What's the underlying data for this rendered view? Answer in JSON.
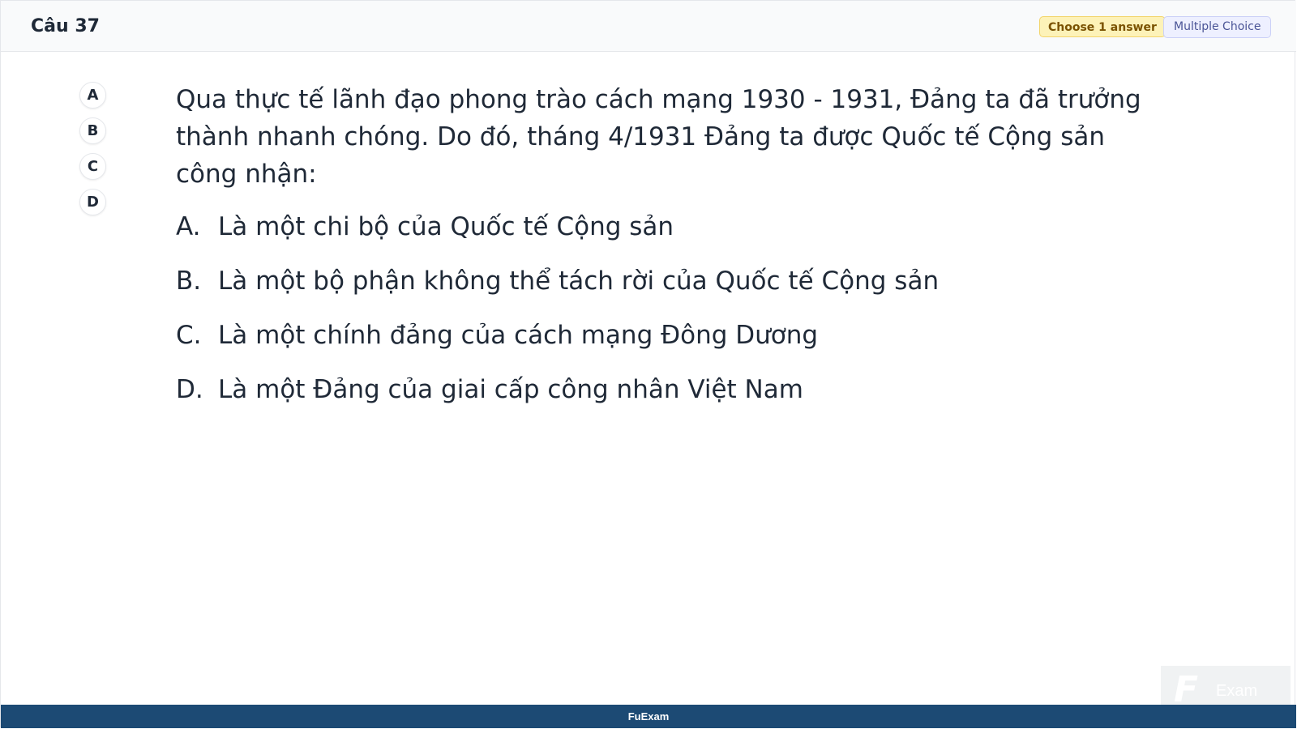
{
  "header": {
    "title": "Câu 37",
    "badge_choose": "Choose 1 answer",
    "badge_type": "Multiple Choice"
  },
  "option_buttons": [
    "A",
    "B",
    "C",
    "D"
  ],
  "question": {
    "text": "Qua thực tế lãnh đạo phong trào cách mạng 1930 - 1931, Đảng ta đã trưởng thành nhanh chóng. Do đó, tháng 4/1931 Đảng ta được Quốc tế Cộng sản công nhận:"
  },
  "answers": [
    {
      "letter": "A.",
      "text": "Là một chi bộ của Quốc tế Cộng sản"
    },
    {
      "letter": "B.",
      "text": "Là một bộ phận không thể tách rời của Quốc tế Cộng sản"
    },
    {
      "letter": "C.",
      "text": "Là một chính đảng của cách mạng Đông Dương"
    },
    {
      "letter": "D.",
      "text": "Là một Đảng của giai cấp công nhân Việt Nam"
    }
  ],
  "watermark": {
    "mark": "F",
    "word": "Exam"
  },
  "footer": {
    "brand": "FuExam"
  }
}
